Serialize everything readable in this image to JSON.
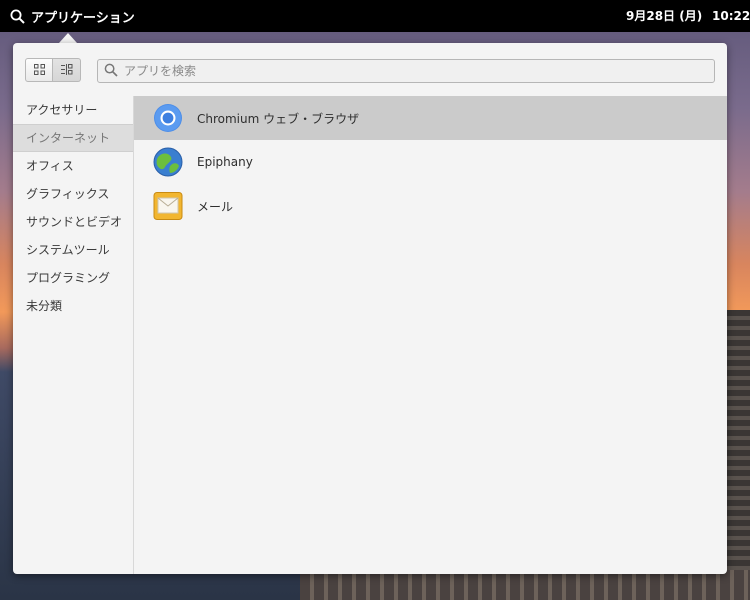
{
  "panel": {
    "app_menu_label": "アプリケーション",
    "date": "9月28日 (月)",
    "time": "10:22"
  },
  "toolbar": {
    "grid_view_icon": "grid-view-icon",
    "category_view_icon": "category-view-icon"
  },
  "search": {
    "placeholder": "アプリを検索"
  },
  "sidebar": {
    "items": [
      {
        "label": "アクセサリー"
      },
      {
        "label": "インターネット",
        "selected": true
      },
      {
        "label": "オフィス"
      },
      {
        "label": "グラフィックス"
      },
      {
        "label": "サウンドとビデオ"
      },
      {
        "label": "システムツール"
      },
      {
        "label": "プログラミング"
      },
      {
        "label": "未分類"
      }
    ]
  },
  "apps": [
    {
      "label": "Chromium ウェブ・ブラウザ",
      "icon": "chromium-icon",
      "selected": true
    },
    {
      "label": "Epiphany",
      "icon": "epiphany-icon"
    },
    {
      "label": "メール",
      "icon": "mail-icon"
    }
  ]
}
